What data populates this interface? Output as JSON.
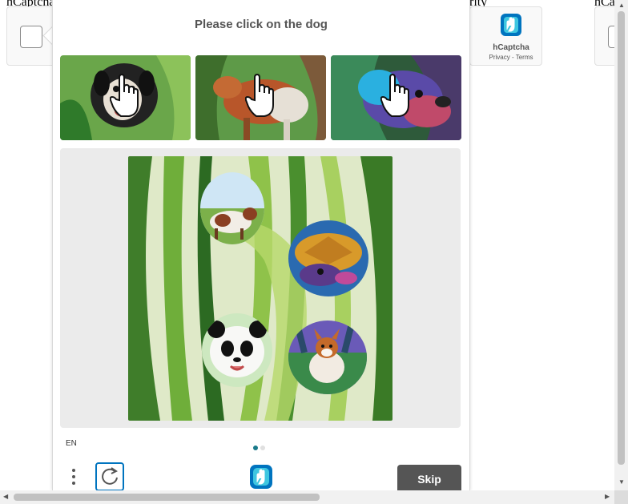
{
  "background_page": {
    "text_left": "hCaptcha",
    "text_mid": "rity",
    "text_right": "hCa"
  },
  "brand": {
    "name": "hCaptcha",
    "links": "Privacy - Terms"
  },
  "challenge": {
    "prompt": "Please click on the dog",
    "examples": [
      {
        "subject": "dog"
      },
      {
        "subject": "dog"
      },
      {
        "subject": "dog"
      }
    ],
    "task_subjects": [
      "cow",
      "turtle",
      "panda",
      "dog"
    ]
  },
  "footer": {
    "language": "EN",
    "page_indicator": {
      "current": 1,
      "total": 2
    },
    "skip_label": "Skip"
  },
  "colors": {
    "accent": "#0074bf",
    "skip_button": "#555555",
    "dot_active": "#1a7a8a",
    "dot_inactive": "#e0e0e0"
  },
  "icons": {
    "menu": "more-vertical-icon",
    "refresh": "refresh-icon",
    "logo": "hcaptcha-logo-icon",
    "example_cursor": "hand-pointer-icon"
  }
}
